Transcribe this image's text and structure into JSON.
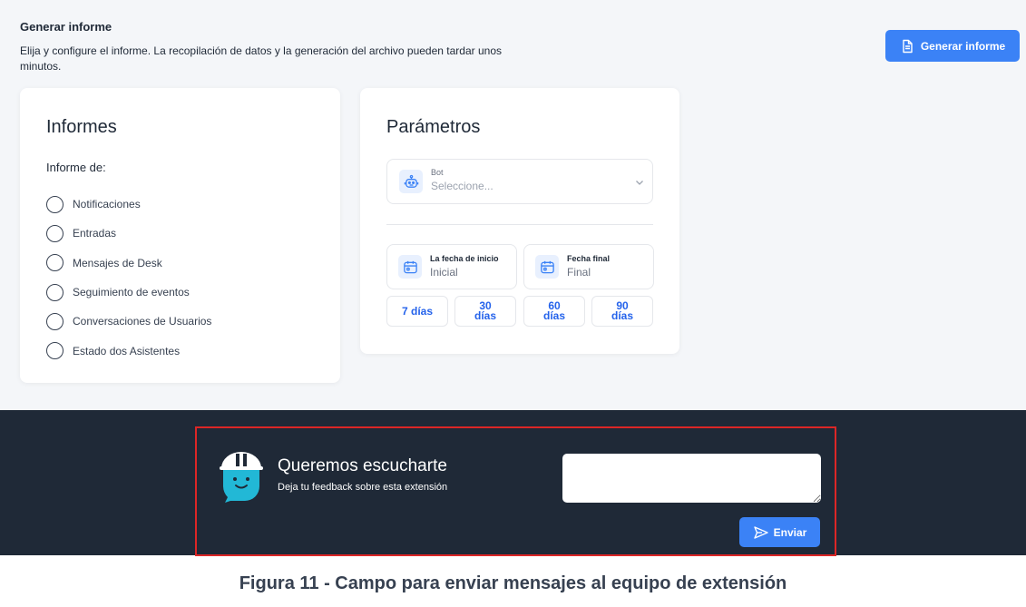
{
  "header": {
    "title": "Generar informe",
    "description": "Elija y configure el informe. La recopilación de datos y la generación del archivo pueden tardar unos minutos.",
    "generate_button": "Generar informe"
  },
  "informes": {
    "title": "Informes",
    "subtitle": "Informe de:",
    "options": [
      {
        "label": "Notificaciones"
      },
      {
        "label": "Entradas"
      },
      {
        "label": "Mensajes de Desk"
      },
      {
        "label": "Seguimiento de eventos"
      },
      {
        "label": "Conversaciones de Usuarios"
      },
      {
        "label": "Estado dos Asistentes"
      }
    ]
  },
  "parametros": {
    "title": "Parámetros",
    "bot": {
      "label": "Bot",
      "placeholder": "Seleccione..."
    },
    "start_date": {
      "label": "La fecha de inicio",
      "value": "Inicial"
    },
    "end_date": {
      "label": "Fecha final",
      "value": "Final"
    },
    "quick_ranges": [
      "7 días",
      "30 días",
      "60 días",
      "90 días"
    ]
  },
  "feedback": {
    "title": "Queremos escucharte",
    "subtitle": "Deja tu feedback sobre esta extensión",
    "input_value": "",
    "send_button": "Enviar"
  },
  "caption": "Figura 11 - Campo para enviar mensajes al equipo de extensión",
  "colors": {
    "accent": "#3b82f6",
    "footer_bg": "#1f2937",
    "highlight_border": "#dc2626",
    "mascot": "#22b8d6"
  }
}
